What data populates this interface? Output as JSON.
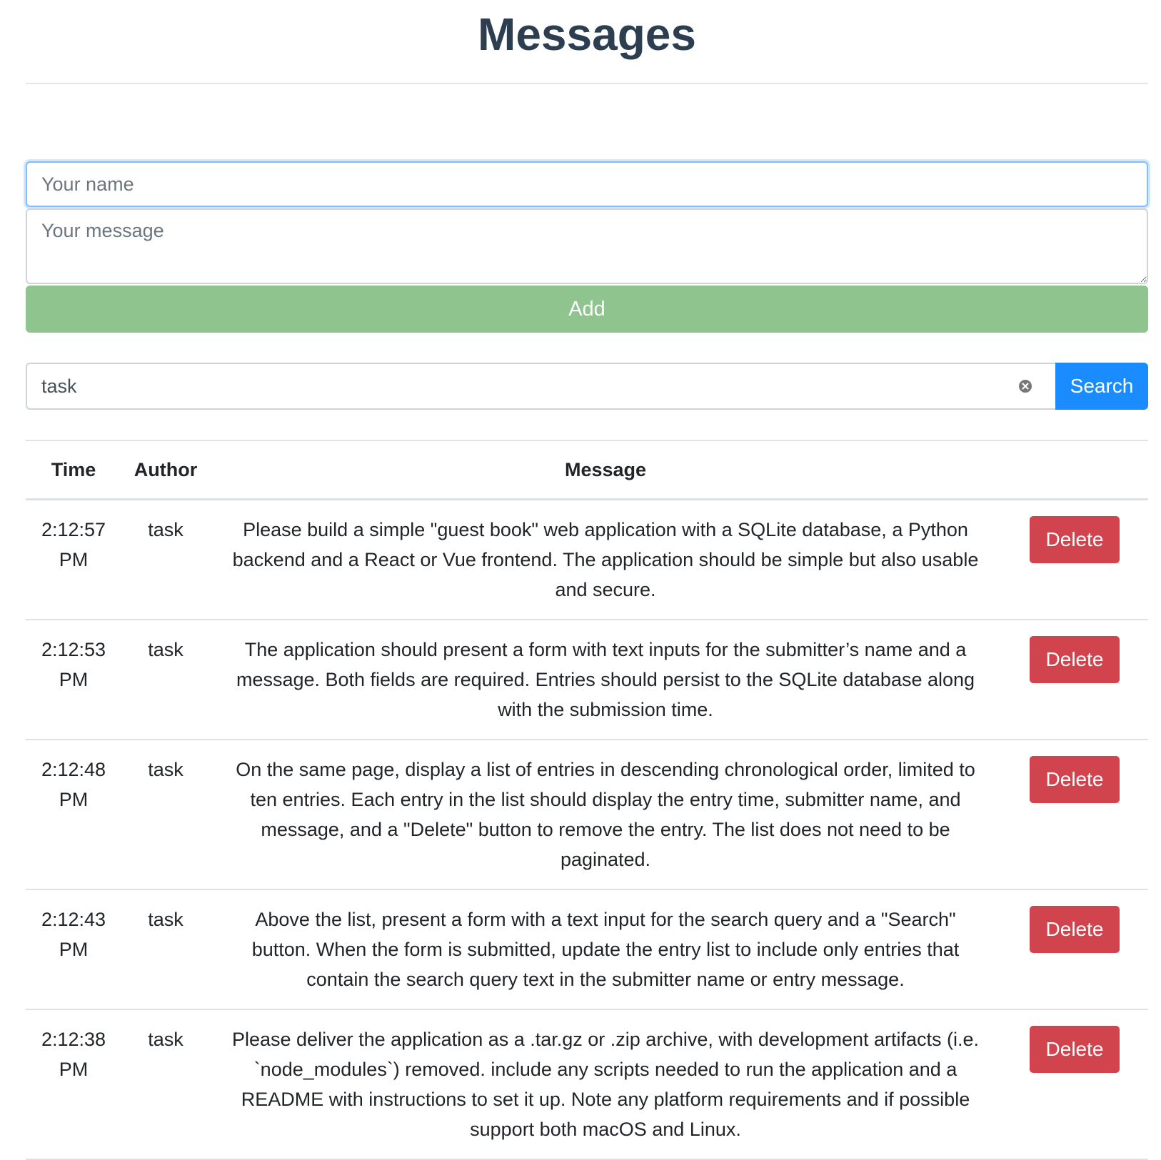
{
  "header": {
    "title": "Messages"
  },
  "form": {
    "name_placeholder": "Your name",
    "message_placeholder": "Your message",
    "add_label": "Add"
  },
  "search": {
    "value": "task",
    "button_label": "Search"
  },
  "table": {
    "headers": {
      "time": "Time",
      "author": "Author",
      "message": "Message"
    },
    "rows": [
      {
        "time": "2:12:57 PM",
        "author": "task",
        "message": "Please build a simple \"guest book\" web application with a SQLite database, a Python backend and a React or Vue frontend. The application should be simple but also usable and secure.",
        "delete_label": "Delete"
      },
      {
        "time": "2:12:53 PM",
        "author": "task",
        "message": "The application should present a form with text inputs for the submitter’s name and a message. Both fields are required. Entries should persist to the SQLite database along with the submission time.",
        "delete_label": "Delete"
      },
      {
        "time": "2:12:48 PM",
        "author": "task",
        "message": "On the same page, display a list of entries in descending chronological order, limited to ten entries. Each entry in the list should display the entry time, submitter name, and message, and a \"Delete\" button to remove the entry. The list does not need to be paginated.",
        "delete_label": "Delete"
      },
      {
        "time": "2:12:43 PM",
        "author": "task",
        "message": "Above the list, present a form with a text input for the search query and a \"Search\" button. When the form is submitted, update the entry list to include only entries that contain the search query text in the submitter name or entry message.",
        "delete_label": "Delete"
      },
      {
        "time": "2:12:38 PM",
        "author": "task",
        "message": "Please deliver the application as a .tar.gz or .zip archive, with development artifacts (i.e. `node_modules`) removed. include any scripts needed to run the application and a README with instructions to set it up. Note any platform requirements and if possible support both macOS and Linux.",
        "delete_label": "Delete"
      }
    ]
  },
  "colors": {
    "title": "#2c3e50",
    "add_button": "#8fc48f",
    "search_button": "#1a8cff",
    "delete_button": "#d1434d",
    "focus_border": "#80bdff"
  },
  "icons": {
    "clear": "clear-search-icon"
  }
}
